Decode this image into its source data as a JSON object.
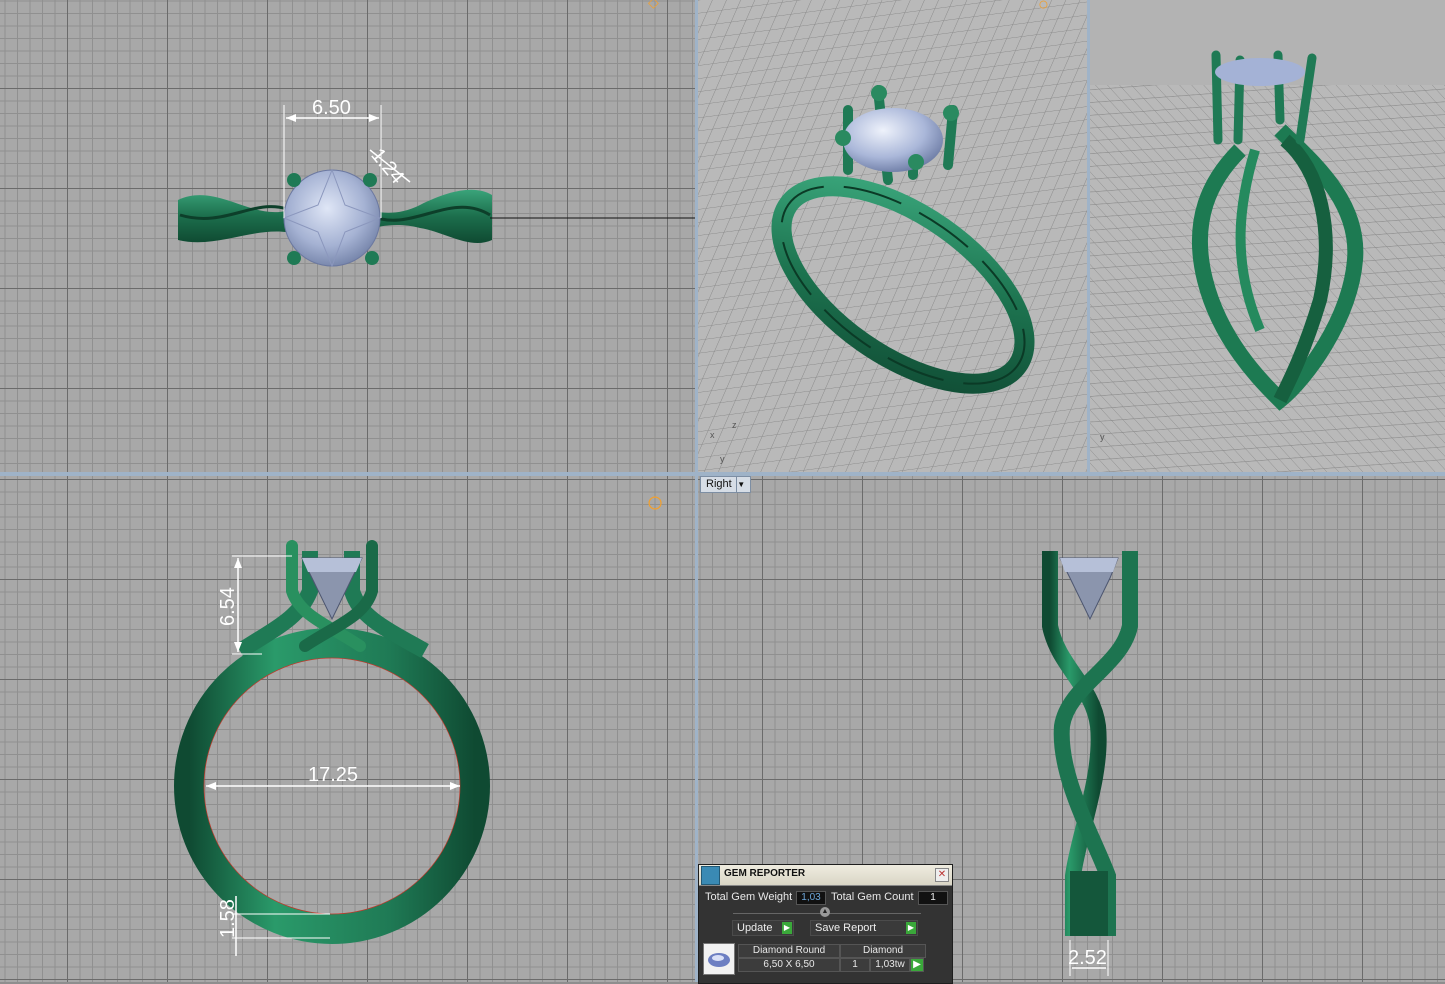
{
  "viewports": {
    "top": {
      "dims": [
        "6.50",
        "1.24"
      ]
    },
    "front": {
      "dims": [
        "6.54",
        "17.25",
        "1.58"
      ]
    },
    "right": {
      "label": "Right",
      "dims": [
        "2.52"
      ]
    },
    "persp_axes": [
      "x",
      "y",
      "z"
    ]
  },
  "gem_reporter": {
    "title": "GEM REPORTER",
    "total_weight_label": "Total Gem Weight",
    "total_weight_value": "1,03",
    "total_count_label": "Total Gem Count",
    "total_count_value": "1",
    "update_label": "Update",
    "save_label": "Save Report",
    "gem": {
      "name": "Diamond Round",
      "size": "6,50 X 6,50",
      "material": "Diamond",
      "count": "1",
      "weight": "1,03tw"
    }
  },
  "colors": {
    "metal": "#1f7a55",
    "gem": "#a9b6d6",
    "grid_bg": "#a8a8a8",
    "dimension_lines": "#ffffff",
    "gizmo": "#f0a030"
  }
}
